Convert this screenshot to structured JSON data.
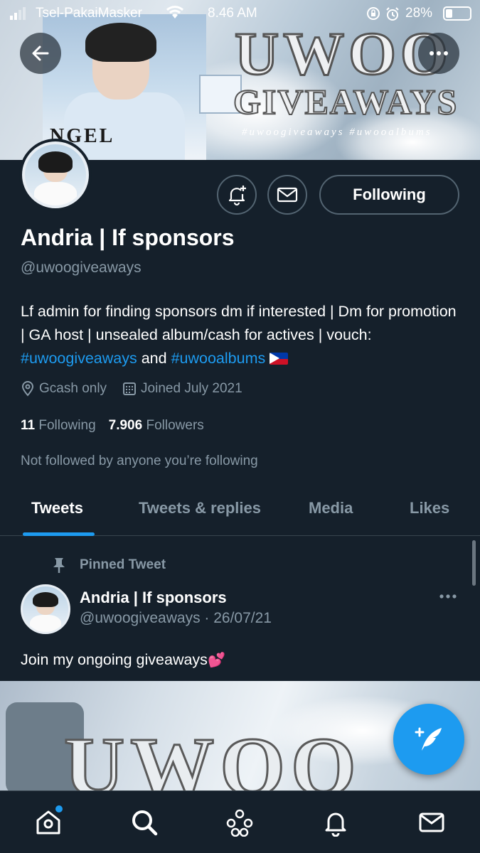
{
  "status_bar": {
    "carrier": "Tsel-PakaiMasker",
    "time": "8.46 AM",
    "battery_pct": "28%"
  },
  "banner": {
    "angel_text": "NGEL",
    "title_line1": "UWOO",
    "title_line2": "GIVEAWAYS",
    "hashtags": "#uwoogiveaways #uwooalbums"
  },
  "profile": {
    "name": "Andria | If sponsors",
    "handle": "@uwoogiveaways",
    "follow_button": "Following",
    "bio_part1": "Lf admin for finding sponsors dm if interested | Dm for promotion | GA host | unsealed album/cash for actives | vouch: ",
    "bio_tag1": "#uwoogiveaways",
    "bio_and": " and ",
    "bio_tag2": "#uwooalbums",
    "location": "Gcash only",
    "joined": "Joined July 2021",
    "following_count": "11",
    "following_label": "Following",
    "followers_count": "7.906",
    "followers_label": "Followers",
    "not_followed": "Not followed by anyone you’re following"
  },
  "tabs": [
    "Tweets",
    "Tweets & replies",
    "Media",
    "Likes"
  ],
  "pinned_tweet": {
    "label": "Pinned Tweet",
    "name": "Andria | If sponsors",
    "handle_date": "@uwoogiveaways · 26/07/21",
    "text": "Join my ongoing giveaways",
    "media_text": "UWOO"
  },
  "colors": {
    "background": "#15202b",
    "accent": "#1d9bf0",
    "muted": "#8899a6",
    "border": "#536471"
  },
  "icons": {
    "back": "arrow-left-icon",
    "more": "ellipsis-icon",
    "notify": "bell-plus-icon",
    "message": "envelope-icon",
    "location": "location-pin-icon",
    "calendar": "calendar-icon",
    "pin": "pin-icon",
    "compose": "compose-feather-icon",
    "nav": [
      "home-icon",
      "search-icon",
      "spaces-icon",
      "notifications-icon",
      "messages-icon"
    ]
  }
}
